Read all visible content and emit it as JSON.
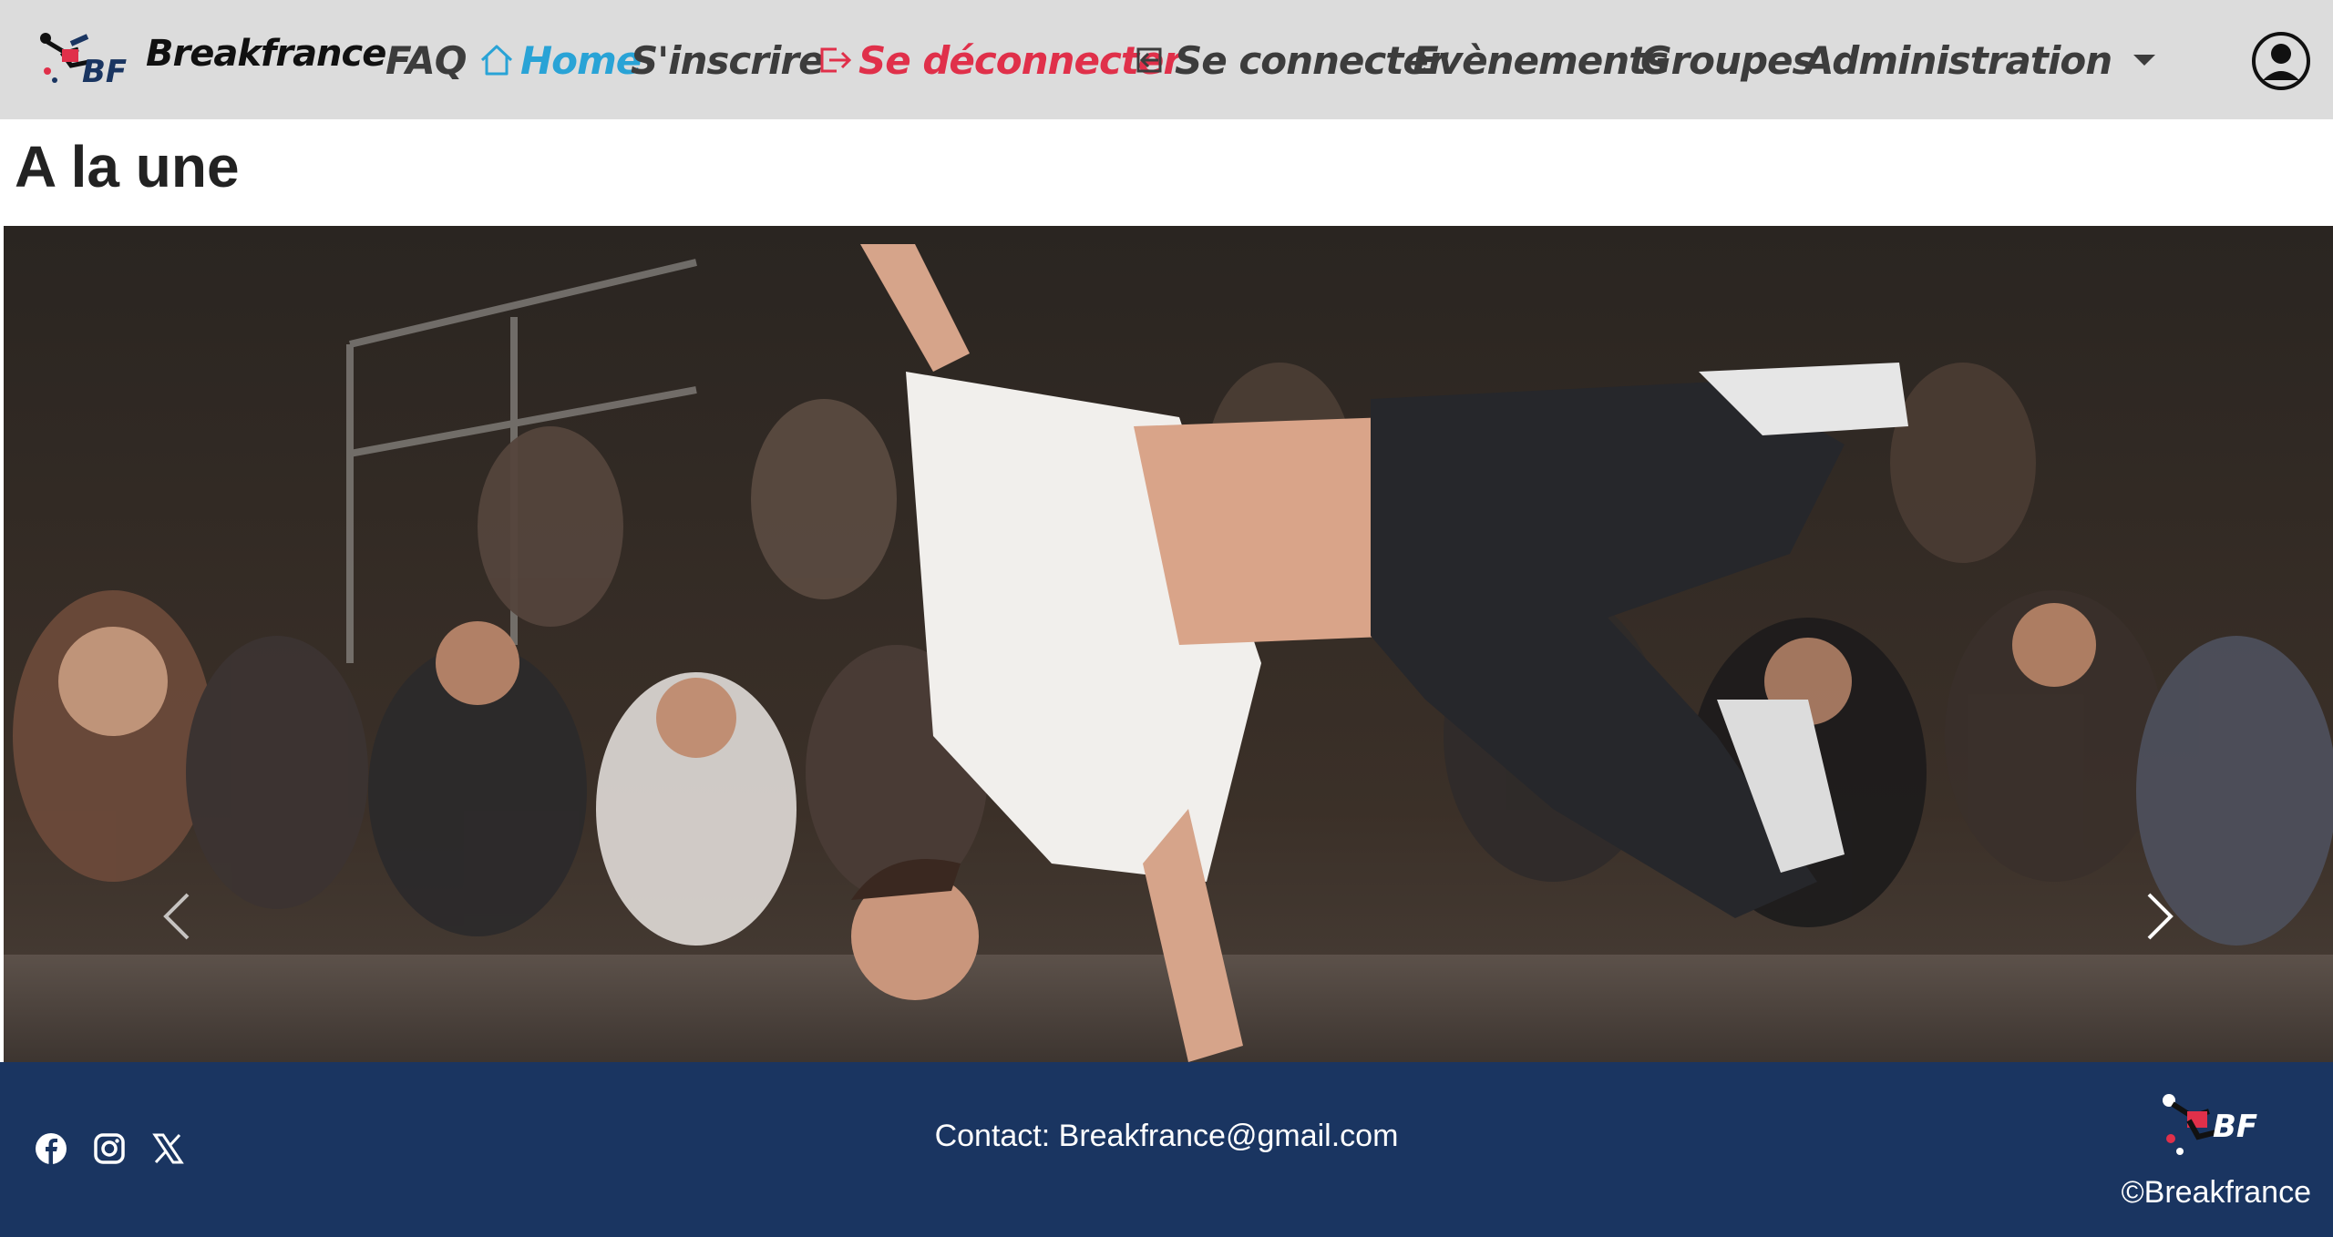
{
  "brand": {
    "name": "Breakfrance",
    "logo_letters": "BF"
  },
  "nav": {
    "faq": "FAQ",
    "home": "Home",
    "register": "S'inscrire",
    "logout": "Se déconnecter",
    "login": "Se connecter",
    "events": "Evènements",
    "groups": "Groupes",
    "admin": "Administration"
  },
  "colors": {
    "navbar_bg": "#dcdcdc",
    "home_active": "#29a3d6",
    "logout": "#e0304a",
    "footer_bg": "#1a3561"
  },
  "icons": {
    "home": "house-icon",
    "logout": "box-arrow-right-icon",
    "login": "box-arrow-in-left-icon",
    "admin_dropdown": "caret-down-icon",
    "profile": "person-circle-icon",
    "carousel_prev": "chevron-left-icon",
    "carousel_next": "chevron-right-icon",
    "facebook": "facebook-icon",
    "instagram": "instagram-icon",
    "x": "x-twitter-icon"
  },
  "main": {
    "title": "A la une"
  },
  "carousel": {
    "image_alt": "Breakdancer performing a freeze in front of a seated crowd"
  },
  "footer": {
    "contact": "Contact: Breakfrance@gmail.com",
    "copyright": "©Breakfrance",
    "logo_letters": "BF"
  }
}
